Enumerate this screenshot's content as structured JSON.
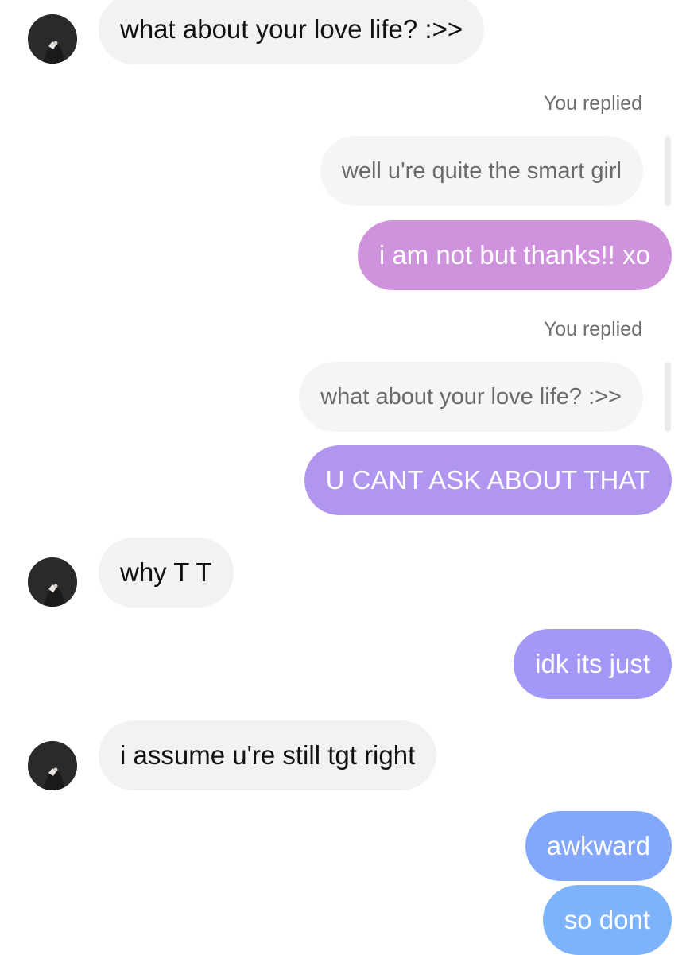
{
  "conversation": {
    "messages": [
      {
        "id": "m1",
        "from": "them",
        "text": "what about your love life? :>>"
      },
      {
        "id": "m2",
        "from": "me",
        "reply_label": "You replied",
        "quoted": "well u're quite the smart girl",
        "text": "i am not but thanks!! xo",
        "color": "#cf93de"
      },
      {
        "id": "m3",
        "from": "me",
        "reply_label": "You replied",
        "quoted": "what about your love life? :>>",
        "text": "U CANT ASK ABOUT THAT",
        "color": "#b196f0"
      },
      {
        "id": "m4",
        "from": "them",
        "text": "why T T"
      },
      {
        "id": "m5",
        "from": "me",
        "text": "idk its just",
        "color": "#a198f7"
      },
      {
        "id": "m6",
        "from": "them",
        "text": "i assume u're still tgt right"
      },
      {
        "id": "m7",
        "from": "me",
        "text": "awkward",
        "color": "#83a8fb"
      },
      {
        "id": "m8",
        "from": "me",
        "text": "so dont",
        "color": "#7db3fb"
      }
    ]
  },
  "colors": {
    "incoming_bubble": "#f2f2f4",
    "quoted_bubble": "#f5f5f6",
    "avatar": "#2a2a2c"
  },
  "icons": {
    "contact_avatar": "avatar-icon"
  }
}
